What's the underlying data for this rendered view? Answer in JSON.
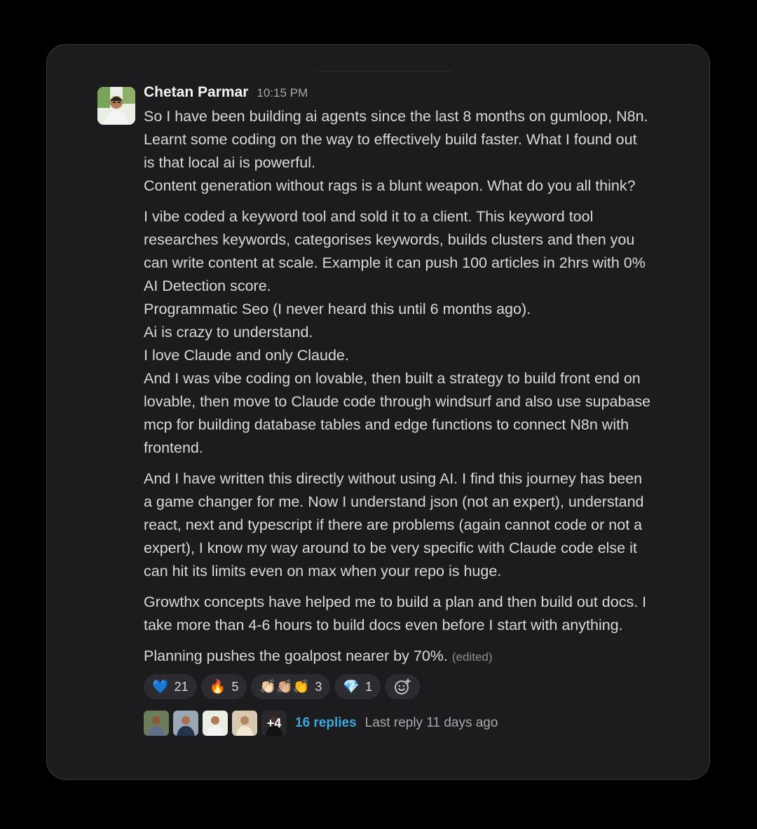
{
  "message": {
    "author": "Chetan Parmar",
    "time": "10:15 PM",
    "lines": [
      "So I have been building ai agents since the last 8 months on gumloop, N8n.",
      "Learnt some coding on the way to effectively build faster. What I found out",
      "is that local ai is powerful.",
      "Content generation without rags is a blunt weapon. What do you all think?",
      "",
      "I vibe coded a keyword tool and sold it to a client. This keyword tool",
      "researches keywords, categorises keywords, builds clusters and then you",
      "can write content at scale. Example it can push 100 articles in 2hrs with 0%",
      "AI Detection score.",
      "Programmatic Seo (I never heard this until 6 months ago).",
      "Ai is crazy to understand.",
      "I love Claude and only Claude.",
      "And I was vibe coding on lovable, then built a strategy to build front end on",
      "lovable, then move to Claude code through windsurf and also use supabase",
      "mcp for building database tables and edge functions to connect N8n with",
      "frontend.",
      "",
      "And I have written this directly without using AI. I find this journey has been",
      "a game changer for me. Now I understand json (not an expert), understand",
      "react, next and typescript if there are problems (again cannot code or not a",
      "expert), I know my way around to be very specific with Claude code else it",
      "can hit its limits even on max when your repo is huge.",
      "",
      "Growthx concepts have helped me to build a plan and then build out docs. I",
      "take more than 4-6 hours to build docs even before I start with anything.",
      "",
      "Planning pushes the goalpost nearer by 70%."
    ],
    "edited_label": "(edited)"
  },
  "reactions": [
    {
      "emoji": "💙",
      "count": "21",
      "icon": "blue-heart-icon"
    },
    {
      "emoji": "🔥",
      "count": "5",
      "icon": "fire-icon"
    },
    {
      "emoji": "👏🏻👏🏼👏",
      "count": "3",
      "icon": "clap-icon"
    },
    {
      "emoji": "💎",
      "count": "1",
      "icon": "gem-icon"
    }
  ],
  "thread": {
    "extra_participants": "+4",
    "replies": "16 replies",
    "last_reply": "Last reply 11 days ago"
  }
}
